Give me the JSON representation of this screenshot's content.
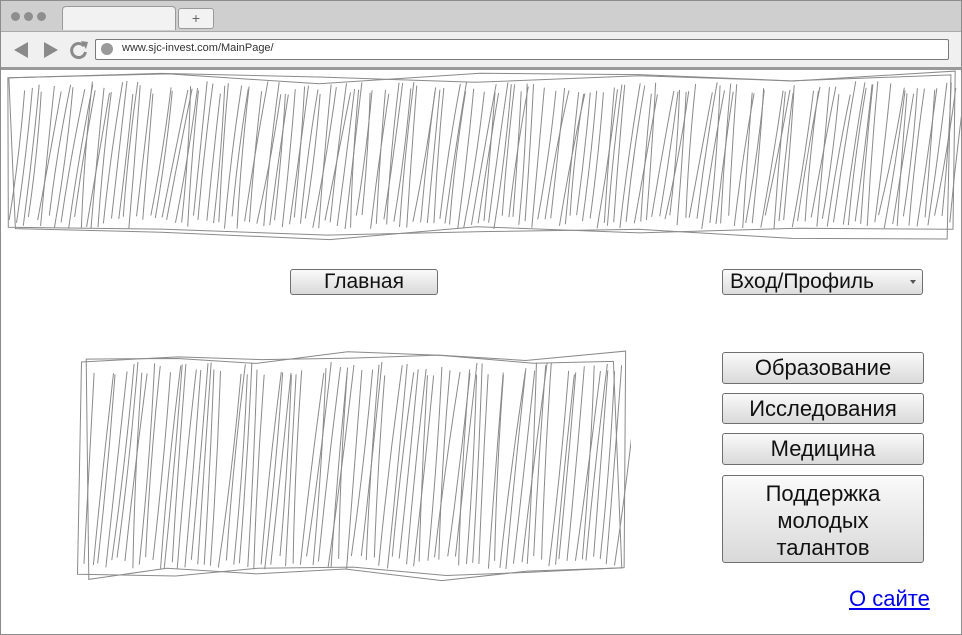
{
  "browser": {
    "new_tab_symbol": "+",
    "url": "www.sjc-invest.com/MainPage/",
    "nav_icons": [
      "back-icon",
      "forward-icon",
      "reload-icon"
    ]
  },
  "page": {
    "home_button": "Главная",
    "login_select": "Вход/Профиль",
    "categories": [
      "Образование",
      "Исследования",
      "Медицина"
    ],
    "youth_support": [
      "Поддержка",
      "молодых",
      "талантов"
    ],
    "about_link": "О сайте"
  },
  "colors": {
    "link": "#0000ee",
    "scribble": "#8a8a8a"
  }
}
